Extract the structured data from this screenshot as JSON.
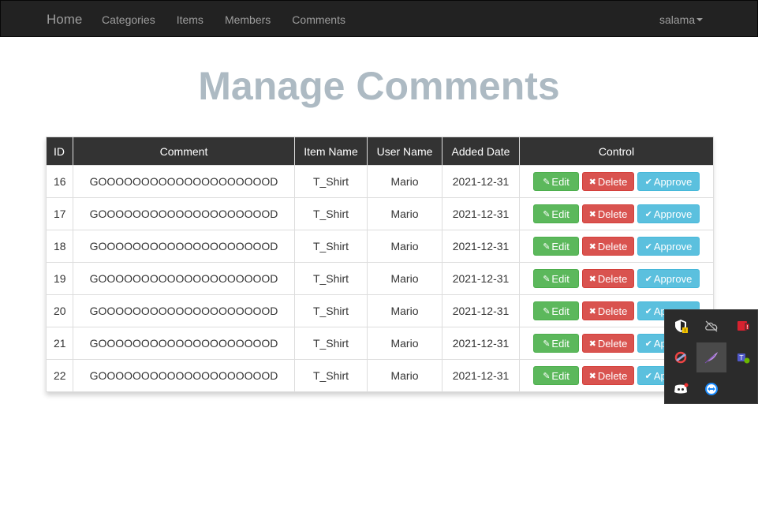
{
  "nav": {
    "brand": "Home",
    "links": [
      "Categories",
      "Items",
      "Members",
      "Comments"
    ],
    "user": "salama"
  },
  "page": {
    "title": "Manage Comments"
  },
  "table": {
    "headers": [
      "ID",
      "Comment",
      "Item Name",
      "User Name",
      "Added Date",
      "Control"
    ],
    "rows": [
      [
        "16",
        "GOOOOOOOOOOOOOOOOOOOOD",
        "T_Shirt",
        "Mario",
        "2021-12-31"
      ],
      [
        "17",
        "GOOOOOOOOOOOOOOOOOOOOD",
        "T_Shirt",
        "Mario",
        "2021-12-31"
      ],
      [
        "18",
        "GOOOOOOOOOOOOOOOOOOOOD",
        "T_Shirt",
        "Mario",
        "2021-12-31"
      ],
      [
        "19",
        "GOOOOOOOOOOOOOOOOOOOOD",
        "T_Shirt",
        "Mario",
        "2021-12-31"
      ],
      [
        "20",
        "GOOOOOOOOOOOOOOOOOOOOD",
        "T_Shirt",
        "Mario",
        "2021-12-31"
      ],
      [
        "21",
        "GOOOOOOOOOOOOOOOOOOOOD",
        "T_Shirt",
        "Mario",
        "2021-12-31"
      ],
      [
        "22",
        "GOOOOOOOOOOOOOOOOOOOOD",
        "T_Shirt",
        "Mario",
        "2021-12-31"
      ]
    ]
  },
  "buttons": {
    "edit": "Edit",
    "delete": "Delete",
    "approve": "Approve",
    "edit_icon": "edit-icon",
    "delete_icon": "times-icon",
    "approve_icon": "check-icon"
  },
  "colors": {
    "navbar": "#222222",
    "title": "#adbac3",
    "edit": "#5cb85c",
    "delete": "#d9534f",
    "approve": "#5bc0de"
  },
  "tray": {
    "icons": [
      "security-warning-icon",
      "cloud-offline-icon",
      "adobe-alert-icon",
      "ccleaner-icon",
      "feather-icon",
      "teams-icon",
      "discord-icon",
      "teamviewer-icon"
    ]
  }
}
